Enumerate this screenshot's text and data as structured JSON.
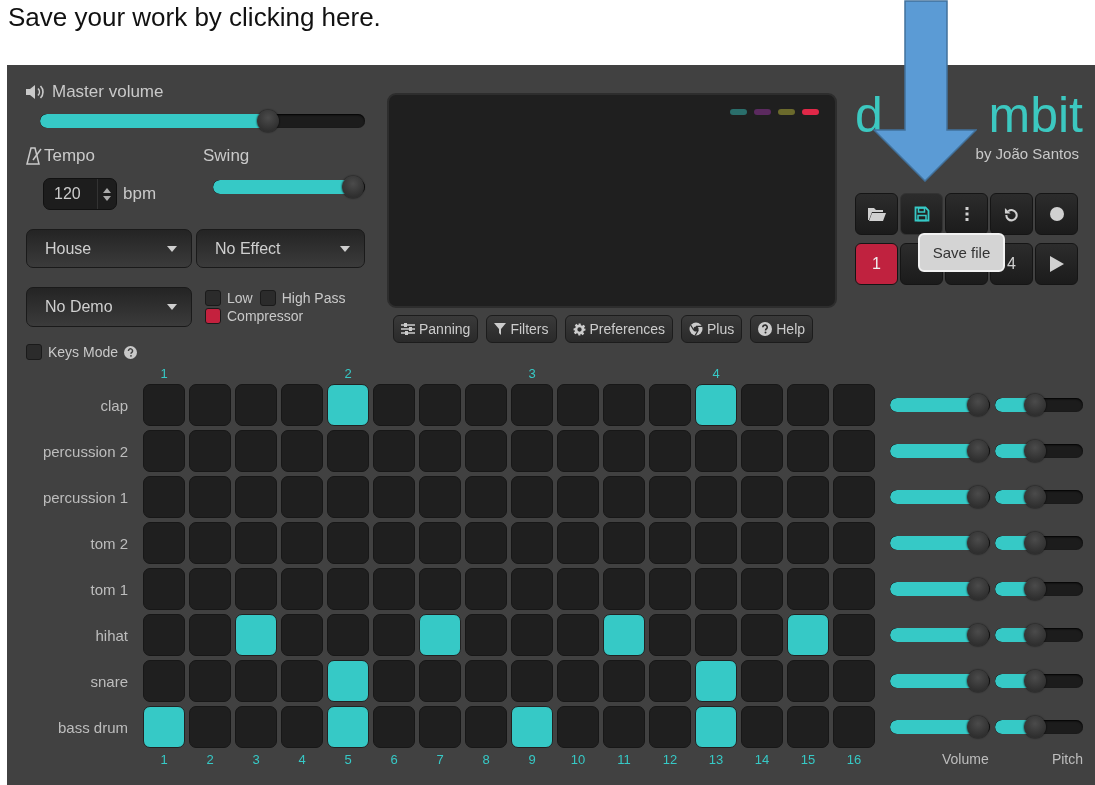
{
  "note": "Save your work by clicking here.",
  "master_volume": {
    "label": "Master volume",
    "level": 0.7
  },
  "tempo": {
    "label": "Tempo",
    "value": "120",
    "unit": "bpm"
  },
  "swing": {
    "label": "Swing",
    "level": 0.92
  },
  "dropdowns": [
    {
      "value": "House"
    },
    {
      "value": "No Effect"
    },
    {
      "value": "No Demo"
    }
  ],
  "effects": [
    {
      "label": "Low",
      "checked": false
    },
    {
      "label": "High Pass",
      "checked": false
    },
    {
      "label": "Compressor",
      "checked": true
    }
  ],
  "keys_mode": {
    "label": "Keys Mode",
    "checked": false
  },
  "display": {
    "indicators": [
      {
        "color": "#2a6e6b"
      },
      {
        "color": "#5b2a5f"
      },
      {
        "color": "#6b6a2c"
      },
      {
        "color": "#e02848"
      }
    ]
  },
  "panel_buttons": [
    {
      "kind": "panning",
      "label": "Panning"
    },
    {
      "kind": "filters",
      "label": "Filters"
    },
    {
      "kind": "preferences",
      "label": "Preferences"
    },
    {
      "kind": "plus",
      "label": "Plus"
    },
    {
      "kind": "help",
      "label": "Help"
    }
  ],
  "logo": {
    "parts": [
      "d",
      "mbit"
    ],
    "byline": "by João Santos"
  },
  "toolbar": [
    {
      "kind": "open",
      "active": false
    },
    {
      "kind": "save",
      "active": true
    },
    {
      "kind": "more",
      "active": false
    },
    {
      "kind": "undo",
      "active": false
    },
    {
      "kind": "record",
      "active": false
    }
  ],
  "patterns": [
    {
      "label": "1",
      "selected": true
    },
    {
      "selected": false
    },
    {
      "selected": false
    },
    {
      "label": "4",
      "selected": false
    }
  ],
  "tooltip": "Save file",
  "bar_numbers": [
    "1",
    "2",
    "3",
    "4"
  ],
  "tracks": [
    {
      "name": "clap",
      "steps": [
        false,
        false,
        false,
        false,
        true,
        false,
        false,
        false,
        false,
        false,
        false,
        false,
        true,
        false,
        false,
        false
      ],
      "volume": {
        "level": 0.88
      },
      "pitch": {
        "level": 0.45
      }
    },
    {
      "name": "percussion 2",
      "steps": [
        false,
        false,
        false,
        false,
        false,
        false,
        false,
        false,
        false,
        false,
        false,
        false,
        false,
        false,
        false,
        false
      ],
      "volume": {
        "level": 0.88
      },
      "pitch": {
        "level": 0.45
      }
    },
    {
      "name": "percussion 1",
      "steps": [
        false,
        false,
        false,
        false,
        false,
        false,
        false,
        false,
        false,
        false,
        false,
        false,
        false,
        false,
        false,
        false
      ],
      "volume": {
        "level": 0.88
      },
      "pitch": {
        "level": 0.45
      }
    },
    {
      "name": "tom 2",
      "steps": [
        false,
        false,
        false,
        false,
        false,
        false,
        false,
        false,
        false,
        false,
        false,
        false,
        false,
        false,
        false,
        false
      ],
      "volume": {
        "level": 0.88
      },
      "pitch": {
        "level": 0.45
      }
    },
    {
      "name": "tom 1",
      "steps": [
        false,
        false,
        false,
        false,
        false,
        false,
        false,
        false,
        false,
        false,
        false,
        false,
        false,
        false,
        false,
        false
      ],
      "volume": {
        "level": 0.88
      },
      "pitch": {
        "level": 0.45
      }
    },
    {
      "name": "hihat",
      "steps": [
        false,
        false,
        true,
        false,
        false,
        false,
        true,
        false,
        false,
        false,
        true,
        false,
        false,
        false,
        true,
        false
      ],
      "volume": {
        "level": 0.88
      },
      "pitch": {
        "level": 0.45
      }
    },
    {
      "name": "snare",
      "steps": [
        false,
        false,
        false,
        false,
        true,
        false,
        false,
        false,
        false,
        false,
        false,
        false,
        true,
        false,
        false,
        false
      ],
      "volume": {
        "level": 0.88
      },
      "pitch": {
        "level": 0.45
      }
    },
    {
      "name": "bass drum",
      "steps": [
        true,
        false,
        false,
        false,
        true,
        false,
        false,
        false,
        true,
        false,
        false,
        false,
        true,
        false,
        false,
        false
      ],
      "volume": {
        "level": 0.88
      },
      "pitch": {
        "level": 0.45
      }
    }
  ],
  "step_numbers": [
    "1",
    "2",
    "3",
    "4",
    "5",
    "6",
    "7",
    "8",
    "9",
    "10",
    "11",
    "12",
    "13",
    "14",
    "15",
    "16"
  ],
  "slider_labels": [
    "Volume",
    "Pitch"
  ]
}
